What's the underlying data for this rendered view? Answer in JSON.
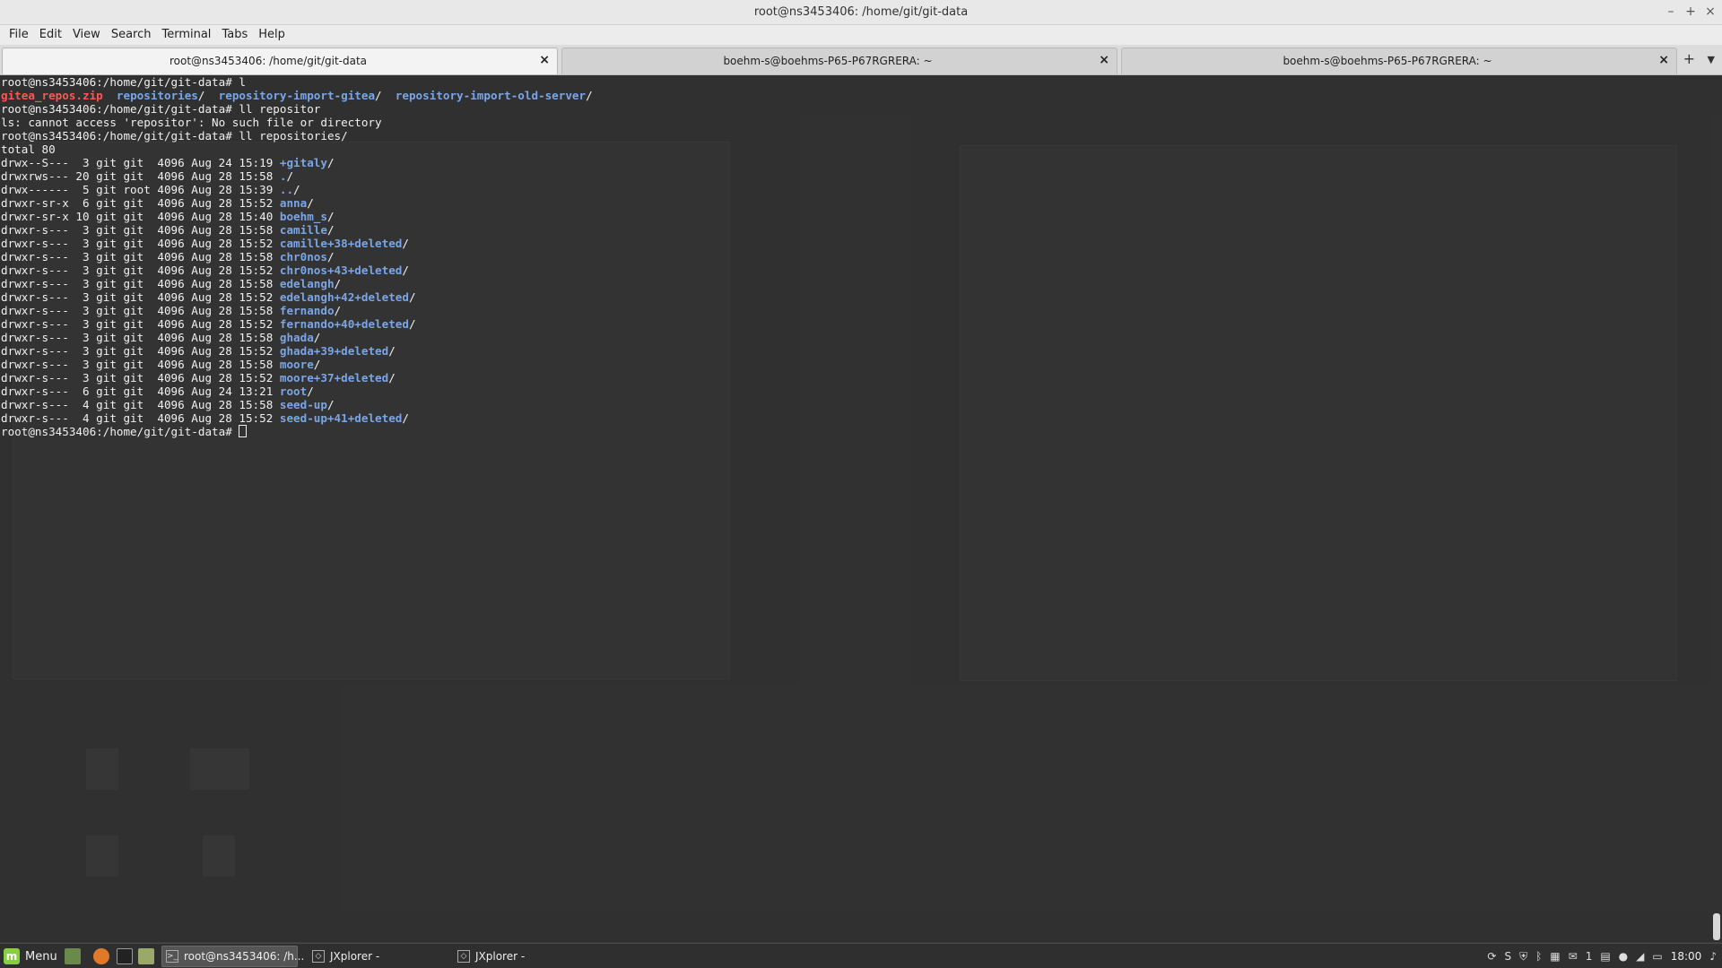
{
  "window": {
    "title": "root@ns3453406: /home/git/git-data",
    "controls": [
      "minimize-icon",
      "maximize-icon",
      "close-icon"
    ]
  },
  "menubar": [
    "File",
    "Edit",
    "View",
    "Search",
    "Terminal",
    "Tabs",
    "Help"
  ],
  "tabs": [
    {
      "label": "root@ns3453406: /home/git/git-data",
      "active": true
    },
    {
      "label": "boehm-s@boehms-P65-P67RGRERA: ~",
      "active": false
    },
    {
      "label": "boehm-s@boehms-P65-P67RGRERA: ~",
      "active": false
    }
  ],
  "terminal": {
    "colors": {
      "foreground": "#f0f0f0",
      "directory": "#7aa6e6",
      "archive": "#ff5555"
    },
    "lines": [
      [
        {
          "t": "root@ns3453406:/home/git/git-data# l"
        }
      ],
      [
        {
          "t": "gitea_repos.zip",
          "c": "red"
        },
        {
          "t": "  "
        },
        {
          "t": "repositories",
          "c": "blue"
        },
        {
          "t": "/  "
        },
        {
          "t": "repository-import-gitea",
          "c": "blue"
        },
        {
          "t": "/  "
        },
        {
          "t": "repository-import-old-server",
          "c": "blue"
        },
        {
          "t": "/"
        }
      ],
      [
        {
          "t": "root@ns3453406:/home/git/git-data# ll repositor"
        }
      ],
      [
        {
          "t": "ls: cannot access 'repositor': No such file or directory"
        }
      ],
      [
        {
          "t": "root@ns3453406:/home/git/git-data# ll repositories/"
        }
      ],
      [
        {
          "t": "total 80"
        }
      ],
      [
        {
          "t": "drwx--S---  3 git git  4096 Aug 24 15:19 "
        },
        {
          "t": "+gitaly",
          "c": "blue"
        },
        {
          "t": "/"
        }
      ],
      [
        {
          "t": "drwxrws--- 20 git git  4096 Aug 28 15:58 "
        },
        {
          "t": ".",
          "c": "blue"
        },
        {
          "t": "/"
        }
      ],
      [
        {
          "t": "drwx------  5 git root 4096 Aug 28 15:39 "
        },
        {
          "t": "..",
          "c": "blue"
        },
        {
          "t": "/"
        }
      ],
      [
        {
          "t": "drwxr-sr-x  6 git git  4096 Aug 28 15:52 "
        },
        {
          "t": "anna",
          "c": "blue"
        },
        {
          "t": "/"
        }
      ],
      [
        {
          "t": "drwxr-sr-x 10 git git  4096 Aug 28 15:40 "
        },
        {
          "t": "boehm_s",
          "c": "blue"
        },
        {
          "t": "/"
        }
      ],
      [
        {
          "t": "drwxr-s---  3 git git  4096 Aug 28 15:58 "
        },
        {
          "t": "camille",
          "c": "blue"
        },
        {
          "t": "/"
        }
      ],
      [
        {
          "t": "drwxr-s---  3 git git  4096 Aug 28 15:52 "
        },
        {
          "t": "camille+38+deleted",
          "c": "blue"
        },
        {
          "t": "/"
        }
      ],
      [
        {
          "t": "drwxr-s---  3 git git  4096 Aug 28 15:58 "
        },
        {
          "t": "chr0nos",
          "c": "blue"
        },
        {
          "t": "/"
        }
      ],
      [
        {
          "t": "drwxr-s---  3 git git  4096 Aug 28 15:52 "
        },
        {
          "t": "chr0nos+43+deleted",
          "c": "blue"
        },
        {
          "t": "/"
        }
      ],
      [
        {
          "t": "drwxr-s---  3 git git  4096 Aug 28 15:58 "
        },
        {
          "t": "edelangh",
          "c": "blue"
        },
        {
          "t": "/"
        }
      ],
      [
        {
          "t": "drwxr-s---  3 git git  4096 Aug 28 15:52 "
        },
        {
          "t": "edelangh+42+deleted",
          "c": "blue"
        },
        {
          "t": "/"
        }
      ],
      [
        {
          "t": "drwxr-s---  3 git git  4096 Aug 28 15:58 "
        },
        {
          "t": "fernando",
          "c": "blue"
        },
        {
          "t": "/"
        }
      ],
      [
        {
          "t": "drwxr-s---  3 git git  4096 Aug 28 15:52 "
        },
        {
          "t": "fernando+40+deleted",
          "c": "blue"
        },
        {
          "t": "/"
        }
      ],
      [
        {
          "t": "drwxr-s---  3 git git  4096 Aug 28 15:58 "
        },
        {
          "t": "ghada",
          "c": "blue"
        },
        {
          "t": "/"
        }
      ],
      [
        {
          "t": "drwxr-s---  3 git git  4096 Aug 28 15:52 "
        },
        {
          "t": "ghada+39+deleted",
          "c": "blue"
        },
        {
          "t": "/"
        }
      ],
      [
        {
          "t": "drwxr-s---  3 git git  4096 Aug 28 15:58 "
        },
        {
          "t": "moore",
          "c": "blue"
        },
        {
          "t": "/"
        }
      ],
      [
        {
          "t": "drwxr-s---  3 git git  4096 Aug 28 15:52 "
        },
        {
          "t": "moore+37+deleted",
          "c": "blue"
        },
        {
          "t": "/"
        }
      ],
      [
        {
          "t": "drwxr-s---  6 git git  4096 Aug 24 13:21 "
        },
        {
          "t": "root",
          "c": "blue"
        },
        {
          "t": "/"
        }
      ],
      [
        {
          "t": "drwxr-s---  4 git git  4096 Aug 28 15:58 "
        },
        {
          "t": "seed-up",
          "c": "blue"
        },
        {
          "t": "/"
        }
      ],
      [
        {
          "t": "drwxr-s---  4 git git  4096 Aug 28 15:52 "
        },
        {
          "t": "seed-up+41+deleted",
          "c": "blue"
        },
        {
          "t": "/"
        }
      ],
      [
        {
          "t": "root@ns3453406:/home/git/git-data# "
        },
        {
          "cursor": true
        }
      ]
    ]
  },
  "taskbar": {
    "menu_label": "Menu",
    "quick_launch": [
      "show-desktop-icon",
      "firefox-icon",
      "terminal-icon",
      "files-icon"
    ],
    "tasks": [
      {
        "label": "root@ns3453406: /h...",
        "icon": "terminal-icon",
        "active": true
      },
      {
        "label": "JXplorer -",
        "icon": "jxplorer-icon",
        "active": false
      },
      {
        "label": "JXplorer -",
        "icon": "jxplorer-icon",
        "active": false
      }
    ],
    "tray": {
      "notifications_count": "1",
      "clock": "18:00"
    }
  }
}
